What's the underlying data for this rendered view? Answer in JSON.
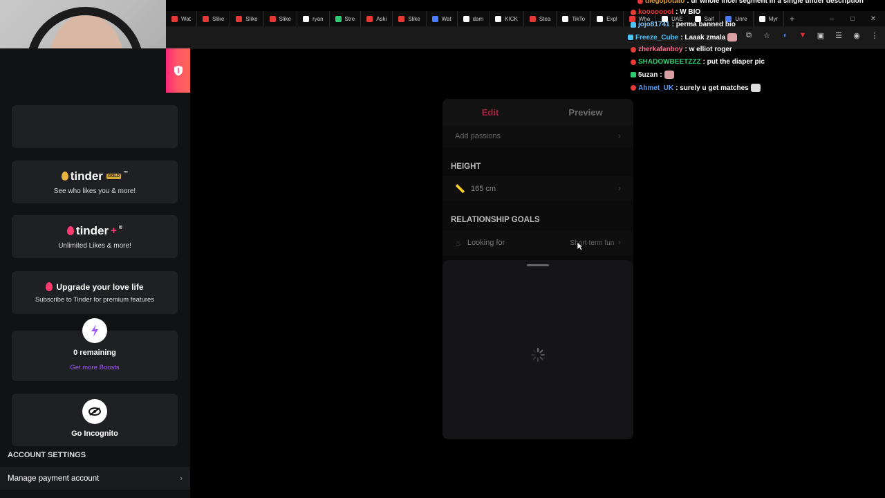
{
  "browser": {
    "tabs": [
      "Wat",
      "Slike",
      "Slike",
      "Slike",
      "ryan",
      "Stre",
      "Aski",
      "Slike",
      "Wat",
      "dam",
      "KICK",
      "Stea",
      "TikTo",
      "Expl",
      "Wha",
      "UAE",
      "Saif",
      "Unre",
      "Myr"
    ],
    "new_tab": "+",
    "min": "–",
    "max": "□",
    "close": "✕"
  },
  "sidebar": {
    "tinder_gold": {
      "brand": "tinder",
      "badge": "GOLD",
      "tm": "™",
      "subtitle": "See who likes you & more!"
    },
    "tinder_plus": {
      "brand": "tinder",
      "plus": "+",
      "reg": "®",
      "subtitle": "Unlimited Likes & more!"
    },
    "upgrade": {
      "title": "Upgrade your love life",
      "subtitle": "Subscribe to Tinder for premium features"
    },
    "boosts": {
      "remaining": "0 remaining",
      "link": "Get more Boosts"
    },
    "incognito": {
      "label": "Go Incognito"
    },
    "account_settings_header": "ACCOUNT SETTINGS",
    "manage_payment": "Manage payment account"
  },
  "editor": {
    "tab_edit": "Edit",
    "tab_preview": "Preview",
    "add_passions": "Add passions",
    "height_header": "HEIGHT",
    "height_value": "165 cm",
    "goals_header": "RELATIONSHIP GOALS",
    "looking_for_label": "Looking for",
    "looking_for_value": "Short-term fun"
  },
  "chat": [
    {
      "user": "diegopotato",
      "text": ": ur whole incel segment in a single tinder description",
      "color": "#e2a03f"
    },
    {
      "user": "koooooool",
      "text": ": W BIO",
      "color": "#e53935"
    },
    {
      "user": "jojo81741",
      "text": ": perma banned bio",
      "color": "#7cc7ff"
    },
    {
      "user": "Freeze_Cube",
      "text": ": Laaak zmala",
      "color": "#4fc3f7"
    },
    {
      "user": "zherkafanboy",
      "text": ": w elliot roger",
      "color": "#ff6f91"
    },
    {
      "user": "SHADOWBEETZZZ",
      "text": ": put the diaper pic",
      "color": "#2ecc71"
    },
    {
      "user": "5uzan",
      "text": ":",
      "color": "#f0f0f0"
    },
    {
      "user": "Ahmet_UK",
      "text": ": surely u get matches",
      "color": "#5aa0ff"
    }
  ],
  "colors": {
    "tinder_red": "#fe3c72",
    "boost_purple": "#a35cff",
    "gold": "#d4a937"
  }
}
